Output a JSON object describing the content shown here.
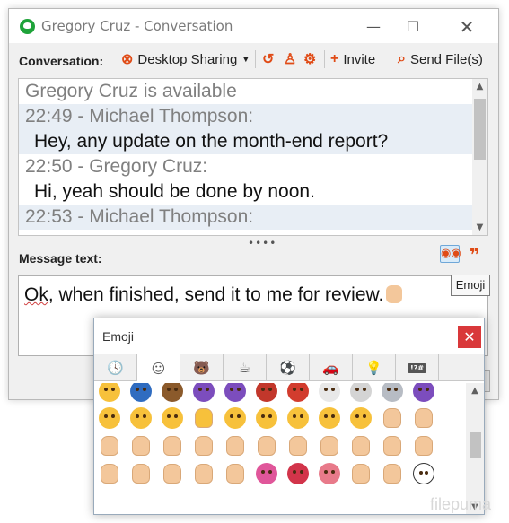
{
  "window": {
    "title": "Gregory Cruz - Conversation",
    "min_glyph": "—",
    "max_glyph": "☐",
    "close_glyph": "✕"
  },
  "toolbar": {
    "label": "Conversation:",
    "desktop_sharing": "Desktop Sharing",
    "invite": "Invite",
    "send_files": "Send File(s)"
  },
  "conversation": [
    {
      "text": "Gregory Cruz is available",
      "style": "gray"
    },
    {
      "text": "22:49 - Michael Thompson:",
      "style": "gray hl"
    },
    {
      "text": "Hey, any update on the month-end report?",
      "style": "dark hl"
    },
    {
      "text": "22:50 - Gregory Cruz:",
      "style": "gray"
    },
    {
      "text": "Hi, yeah should be done by noon.",
      "style": "dark"
    },
    {
      "text": "22:53 - Michael Thompson:",
      "style": "gray hl"
    }
  ],
  "message": {
    "label": "Message text:",
    "text": "Ok, when finished, send it to me for review.",
    "squiggle_word": "Ok"
  },
  "tooltip": "Emoji",
  "emoji_popup": {
    "title": "Emoji",
    "close_glyph": "✕",
    "tabs": [
      {
        "name": "clock",
        "glyph": "🕓"
      },
      {
        "name": "smiley",
        "glyph": "☺"
      },
      {
        "name": "bear",
        "glyph": "🐻"
      },
      {
        "name": "cup",
        "glyph": "☕"
      },
      {
        "name": "ball",
        "glyph": "⚽"
      },
      {
        "name": "car",
        "glyph": "🚗"
      },
      {
        "name": "bulb",
        "glyph": "💡"
      },
      {
        "name": "symbols",
        "glyph": "!?#"
      }
    ],
    "active_tab": 1,
    "rows": [
      [
        {
          "name": "sleepy-face",
          "color": "#f7c13b"
        },
        {
          "name": "zzz",
          "color": "#2f6cc0"
        },
        {
          "name": "poop",
          "color": "#8b5a2b"
        },
        {
          "name": "smiling-imp",
          "color": "#7c4dbd"
        },
        {
          "name": "angry-imp",
          "color": "#7c4dbd"
        },
        {
          "name": "ogre",
          "color": "#c2372b"
        },
        {
          "name": "goblin",
          "color": "#d23c2e"
        },
        {
          "name": "ghost",
          "color": "#e8e8e8"
        },
        {
          "name": "skull",
          "color": "#d4d4d4"
        },
        {
          "name": "alien",
          "color": "#b7bcc4"
        },
        {
          "name": "alien-monster",
          "color": "#7c4dbd"
        }
      ],
      [
        {
          "name": "cat-smile",
          "color": "#f7c13b"
        },
        {
          "name": "cat-grin",
          "color": "#f7c13b"
        },
        {
          "name": "cat-joy",
          "color": "#f7c13b"
        },
        {
          "name": "cat-heart-eyes",
          "color": "#f7c13b"
        },
        {
          "name": "cat-smirk",
          "color": "#f7c13b"
        },
        {
          "name": "cat-kiss",
          "color": "#f7c13b"
        },
        {
          "name": "cat-scream",
          "color": "#f7c13b"
        },
        {
          "name": "cat-cry",
          "color": "#f7c13b"
        },
        {
          "name": "cat-pout",
          "color": "#f7c13b"
        },
        {
          "name": "raised-hands",
          "color": "#f3c79b"
        },
        {
          "name": "clapping",
          "color": "#f3c79b"
        }
      ],
      [
        {
          "name": "thumbs-up",
          "color": "#f3c79b"
        },
        {
          "name": "thumbs-down",
          "color": "#f3c79b"
        },
        {
          "name": "fist",
          "color": "#f3c79b"
        },
        {
          "name": "raised-fist",
          "color": "#f3c79b"
        },
        {
          "name": "waving-hand",
          "color": "#f3c79b"
        },
        {
          "name": "point-left",
          "color": "#f3c79b"
        },
        {
          "name": "point-right",
          "color": "#f3c79b"
        },
        {
          "name": "point-up",
          "color": "#f3c79b"
        },
        {
          "name": "point-down",
          "color": "#f3c79b"
        },
        {
          "name": "ok-hand",
          "color": "#f3c79b"
        },
        {
          "name": "index-up",
          "color": "#f3c79b"
        }
      ],
      [
        {
          "name": "victory-hand",
          "color": "#f3c79b"
        },
        {
          "name": "raised-hand",
          "color": "#f3c79b"
        },
        {
          "name": "open-hands",
          "color": "#f3c79b"
        },
        {
          "name": "flexed-biceps",
          "color": "#f3c79b"
        },
        {
          "name": "folded-hands",
          "color": "#f3c79b"
        },
        {
          "name": "nail-polish",
          "color": "#e0569a"
        },
        {
          "name": "lips",
          "color": "#d2344a"
        },
        {
          "name": "tongue",
          "color": "#e87a8a"
        },
        {
          "name": "ear",
          "color": "#f3c79b"
        },
        {
          "name": "nose",
          "color": "#f3c79b"
        },
        {
          "name": "eyes",
          "color": "#ffffff"
        }
      ]
    ]
  },
  "watermark": "filepuma"
}
